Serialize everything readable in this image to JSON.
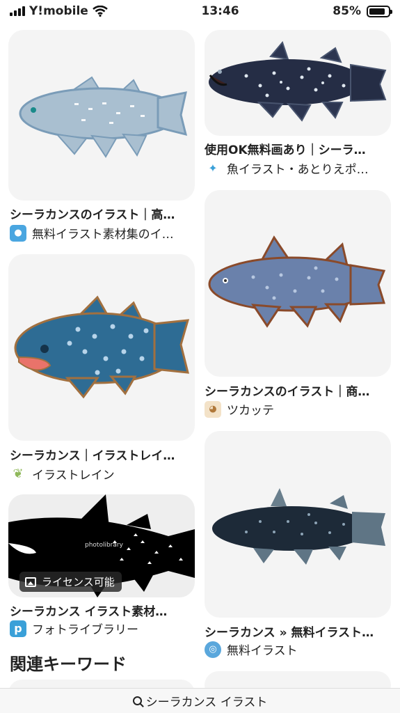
{
  "status": {
    "carrier": "Y!mobile",
    "time": "13:46",
    "battery": "85%",
    "battery_level": 0.85
  },
  "results": [
    {
      "title": "シーラカンスのイラスト｜高…",
      "source": "無料イラスト素材集のイ…"
    },
    {
      "title": "使用OK無料画あり｜シーラ…",
      "source": "魚イラスト・あとりえポ…"
    },
    {
      "title": "シーラカンスのイラスト｜商…",
      "source": "ツカッテ"
    },
    {
      "title": "シーラカンス｜イラストレイ…",
      "source": "イラストレイン"
    },
    {
      "title": "シーラカンス イラスト素材…",
      "source": "フォトライブラリー",
      "badge": "ライセンス可能"
    },
    {
      "title": "シーラカンス » 無料イラスト…",
      "source": "無料イラスト"
    }
  ],
  "related": {
    "title": "関連キーワード"
  },
  "bottom_bar": {
    "query": "シーラカンス イラスト"
  }
}
